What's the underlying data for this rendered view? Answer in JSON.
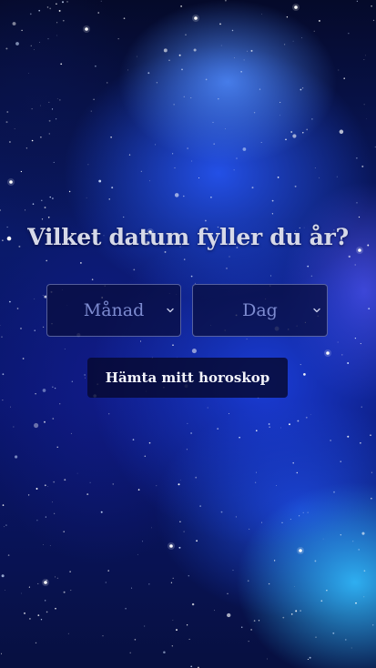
{
  "page": {
    "heading": "Vilket datum fyller du år?"
  },
  "date_picker": {
    "month_select": {
      "selected_label": "Månad",
      "icon": "chevron-down-icon"
    },
    "day_select": {
      "selected_label": "Dag",
      "icon": "chevron-down-icon"
    }
  },
  "actions": {
    "submit_label": "Hämta mitt horoskop"
  },
  "colors": {
    "heading_text": "#d6d9e8",
    "select_text": "#7d8bd0",
    "select_bg": "#080c3c",
    "button_bg": "#060830",
    "button_text": "#f2f3fa",
    "background_deep": "#020412",
    "nebula_blue": "#2a5cff",
    "nebula_cyan": "#32beff"
  }
}
